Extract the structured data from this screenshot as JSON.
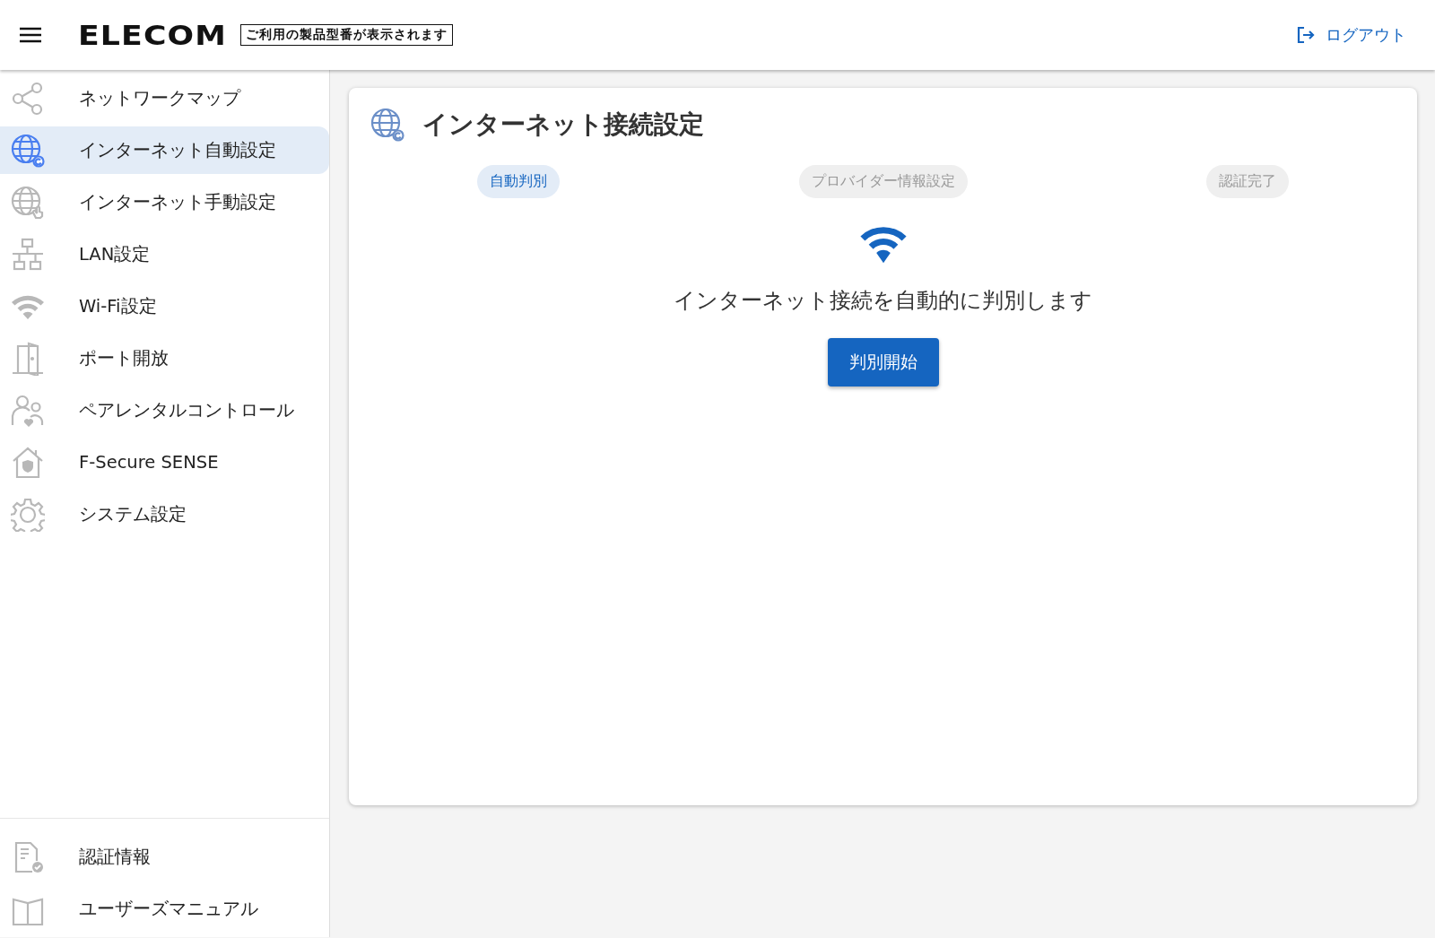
{
  "header": {
    "logo": "ELECOM",
    "model_label": "ご利用の製品型番が表示されます",
    "logout": "ログアウト"
  },
  "sidebar": {
    "items": [
      {
        "label": "ネットワークマップ",
        "selected": false
      },
      {
        "label": "インターネット自動設定",
        "selected": true
      },
      {
        "label": "インターネット手動設定",
        "selected": false
      },
      {
        "label": "LAN設定",
        "selected": false
      },
      {
        "label": "Wi-Fi設定",
        "selected": false
      },
      {
        "label": "ポート開放",
        "selected": false
      },
      {
        "label": "ペアレンタルコントロール",
        "selected": false
      },
      {
        "label": "F-Secure SENSE",
        "selected": false
      },
      {
        "label": "システム設定",
        "selected": false
      }
    ],
    "bottom_items": [
      {
        "label": "認証情報"
      },
      {
        "label": "ユーザーズマニュアル"
      }
    ]
  },
  "card": {
    "title": "インターネット接続設定",
    "steps": [
      {
        "label": "自動判別",
        "selected": true
      },
      {
        "label": "プロバイダー情報設定",
        "selected": false
      },
      {
        "label": "認証完了",
        "selected": false
      }
    ],
    "message": "インターネット接続を自動的に判別します",
    "button": "判別開始"
  }
}
